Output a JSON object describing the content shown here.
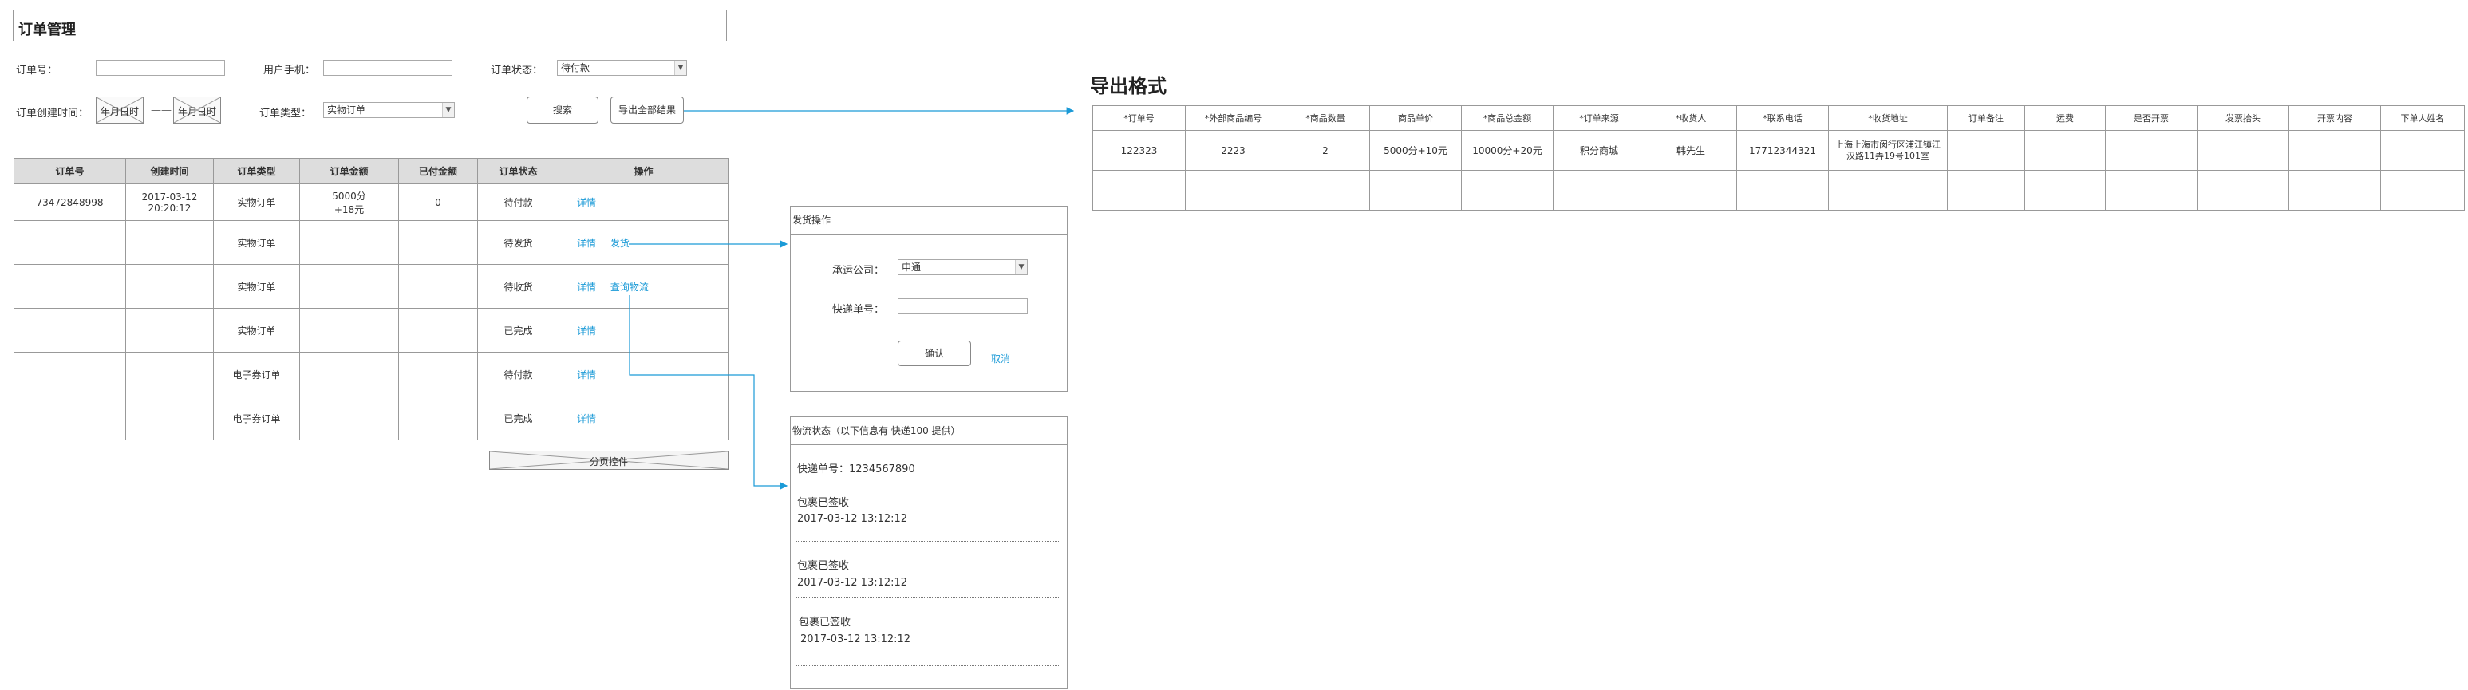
{
  "header": {
    "title": "订单管理"
  },
  "filters": {
    "order_no_label": "订单号：",
    "phone_label": "用户手机：",
    "status_label": "订单状态：",
    "status_value": "待付款",
    "created_label": "订单创建时间：",
    "date_from": "年月日时",
    "date_sep": "——",
    "date_to": "年月日时",
    "type_label": "订单类型：",
    "type_value": "实物订单",
    "search_button": "搜索",
    "export_button": "导出全部结果"
  },
  "orders": {
    "columns": [
      "订单号",
      "创建时间",
      "订单类型",
      "订单金额",
      "已付金额",
      "订单状态",
      "操作"
    ],
    "rows": [
      {
        "order_no": "73472848998",
        "created_date": "2017-03-12",
        "created_time": "20:20:12",
        "type": "实物订单",
        "amount_main": "5000分",
        "amount_sub": "+18元",
        "paid": "0",
        "status": "待付款",
        "action_detail": "详情",
        "action_extra": ""
      },
      {
        "order_no": "",
        "created_date": "",
        "created_time": "",
        "type": "实物订单",
        "amount_main": "",
        "amount_sub": "",
        "paid": "",
        "status": "待发货",
        "action_detail": "详情",
        "action_extra": "发货"
      },
      {
        "order_no": "",
        "created_date": "",
        "created_time": "",
        "type": "实物订单",
        "amount_main": "",
        "amount_sub": "",
        "paid": "",
        "status": "待收货",
        "action_detail": "详情",
        "action_extra": "查询物流"
      },
      {
        "order_no": "",
        "created_date": "",
        "created_time": "",
        "type": "实物订单",
        "amount_main": "",
        "amount_sub": "",
        "paid": "",
        "status": "已完成",
        "action_detail": "详情",
        "action_extra": ""
      },
      {
        "order_no": "",
        "created_date": "",
        "created_time": "",
        "type": "电子券订单",
        "amount_main": "",
        "amount_sub": "",
        "paid": "",
        "status": "待付款",
        "action_detail": "详情",
        "action_extra": ""
      },
      {
        "order_no": "",
        "created_date": "",
        "created_time": "",
        "type": "电子券订单",
        "amount_main": "",
        "amount_sub": "",
        "paid": "",
        "status": "已完成",
        "action_detail": "详情",
        "action_extra": ""
      }
    ],
    "pagination_label": "分页控件"
  },
  "ship_panel": {
    "title": "发货操作",
    "carrier_label": "承运公司：",
    "carrier_value": "申通",
    "tracking_label": "快递单号：",
    "confirm_button": "确认",
    "cancel_link": "取消"
  },
  "logistics_panel": {
    "title": "物流状态（以下信息有 快递100  提供）",
    "tracking_line": "快递单号：1234567890",
    "events": [
      {
        "status": "包裹已签收",
        "time": "2017-03-12 13:12:12"
      },
      {
        "status": "包裹已签收",
        "time": "2017-03-12 13:12:12"
      },
      {
        "status": "包裹已签收",
        "time": "2017-03-12 13:12:12"
      }
    ]
  },
  "export_format": {
    "title": "导出格式",
    "columns": [
      "*订单号",
      "*外部商品编号",
      "*商品数量",
      "商品单价",
      "*商品总金额",
      "*订单来源",
      "*收货人",
      "*联系电话",
      "*收货地址",
      "订单备注",
      "运费",
      "是否开票",
      "发票抬头",
      "开票内容",
      "下单人姓名"
    ],
    "row": [
      "122323",
      "2223",
      "2",
      "5000分+10元",
      "10000分+20元",
      "积分商城",
      "韩先生",
      "17712344321",
      "上海上海市闵行区浦江镇江汉路11弄19号101室",
      "",
      "",
      "",
      "",
      "",
      ""
    ]
  },
  "colors": {
    "accent": "#1a9ad7",
    "header_bg": "#dddddd",
    "border": "#999999"
  },
  "icons": {
    "select_arrow": "chevron-down-icon",
    "date_placeholder": "image-placeholder-icon"
  }
}
